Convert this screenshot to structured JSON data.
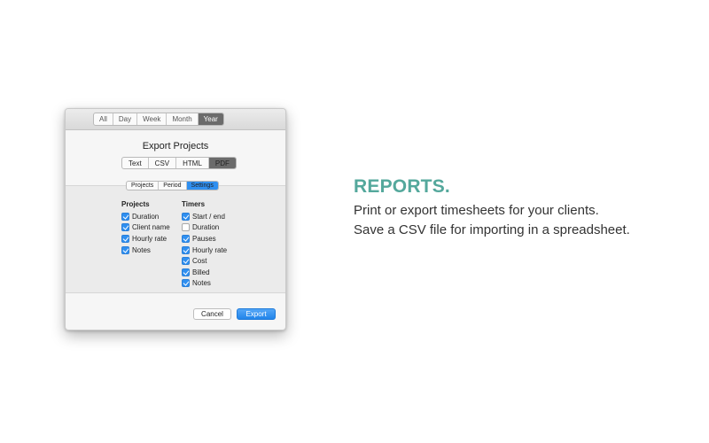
{
  "window": {
    "range_tabs": [
      "All",
      "Day",
      "Week",
      "Month",
      "Year"
    ],
    "selected_range": "Year",
    "dialog_title": "Export Projects",
    "format_tabs": [
      "Text",
      "CSV",
      "HTML",
      "PDF"
    ],
    "selected_format": "PDF",
    "sub_tabs": [
      "Projects",
      "Period",
      "Settings"
    ],
    "selected_sub_tab": "Settings",
    "projects_column": {
      "heading": "Projects",
      "options": [
        {
          "label": "Duration",
          "checked": true
        },
        {
          "label": "Client name",
          "checked": true
        },
        {
          "label": "Hourly rate",
          "checked": true
        },
        {
          "label": "Notes",
          "checked": true
        }
      ]
    },
    "timers_column": {
      "heading": "Timers",
      "options": [
        {
          "label": "Start / end",
          "checked": true
        },
        {
          "label": "Duration",
          "checked": false
        },
        {
          "label": "Pauses",
          "checked": true
        },
        {
          "label": "Hourly rate",
          "checked": true
        },
        {
          "label": "Cost",
          "checked": true
        },
        {
          "label": "Billed",
          "checked": true
        },
        {
          "label": "Notes",
          "checked": true
        }
      ]
    },
    "cancel_label": "Cancel",
    "export_label": "Export"
  },
  "promo": {
    "heading": "REPORTS.",
    "line1": "Print or export timesheets for your clients.",
    "line2": "Save a CSV file for importing in a spreadsheet."
  },
  "colors": {
    "accent_blue": "#2f8ff0",
    "heading_teal": "#54a89c",
    "selected_dark": "#6b6b6b"
  }
}
